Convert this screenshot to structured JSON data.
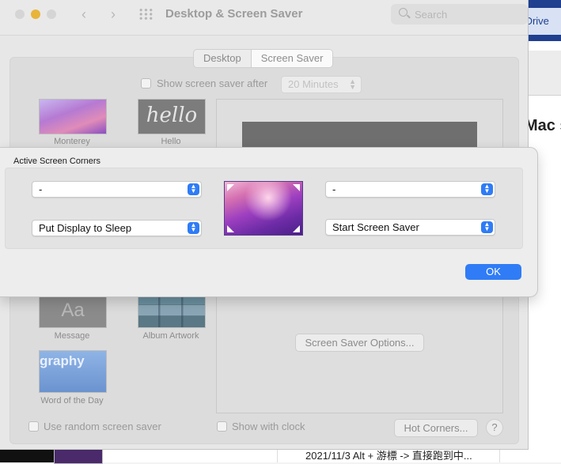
{
  "background_app": {
    "tab_text": "OneDrive",
    "heading": "Mac s",
    "footer_text": "2021/11/3  Alt + 游標 -> 直接跑到中..."
  },
  "window": {
    "title": "Desktop & Screen Saver",
    "search_placeholder": "Search",
    "tabs": [
      "Desktop",
      "Screen Saver"
    ],
    "selected_tab": "Screen Saver",
    "show_after_label": "Show screen saver after",
    "show_after_value": "20 Minutes",
    "savers": [
      {
        "name": "Monterey"
      },
      {
        "name": "Hello",
        "thumb_text": "hello"
      },
      {
        "name": "Message",
        "thumb_text": "Aa"
      },
      {
        "name": "Album Artwork"
      },
      {
        "name": "Word of the Day",
        "thumb_text": "graphy"
      }
    ],
    "options_button": "Screen Saver Options...",
    "random_label": "Use random screen saver",
    "clock_label": "Show with clock",
    "hot_corners_button": "Hot Corners...",
    "help_label": "?"
  },
  "sheet": {
    "title": "Active Screen Corners",
    "top_left": "-",
    "top_right": "-",
    "bottom_left": "Put Display to Sleep",
    "bottom_right": "Start Screen Saver",
    "ok_label": "OK"
  },
  "colors": {
    "accent": "#2f7cf6",
    "window_bg": "#e7e7e7",
    "sheet_bg": "#ededed"
  }
}
